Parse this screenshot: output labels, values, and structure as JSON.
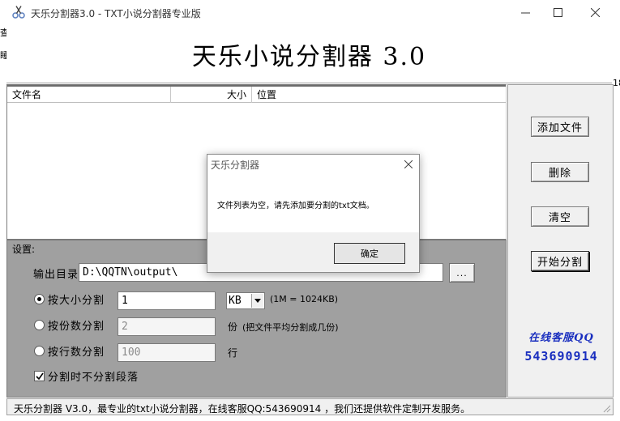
{
  "window": {
    "title": "天乐分割器3.0 - TXT小说分割器专业版",
    "icon": "scissors-icon",
    "controls": [
      "minimize",
      "maximize",
      "close"
    ]
  },
  "edge_fragments": [
    "查",
    "睡",
    "18"
  ],
  "banner": {
    "title": "天乐小说分割器 3.0"
  },
  "file_list": {
    "columns": [
      {
        "label": "文件名"
      },
      {
        "label": "大小"
      },
      {
        "label": "位置"
      }
    ],
    "rows": []
  },
  "right_panel": {
    "buttons": {
      "add_file": "添加文件",
      "delete": "删除",
      "clear": "清空",
      "start_split": "开始分割"
    },
    "service_label": "在线客服QQ",
    "service_number": "543690914"
  },
  "settings": {
    "title": "设置:",
    "output_dir_label": "输出目录",
    "output_dir_value": "D:\\QQTN\\output\\",
    "browse_label": "...",
    "split_by_size": {
      "label": "按大小分割",
      "checked": true,
      "value": "1",
      "unit": "KB",
      "note": "(1M = 1024KB)"
    },
    "split_by_parts": {
      "label": "按份数分割",
      "checked": false,
      "value": "2",
      "unit": "份",
      "note": "(把文件平均分割成几份)"
    },
    "split_by_lines": {
      "label": "按行数分割",
      "checked": false,
      "value": "100",
      "unit": "行"
    },
    "no_split_paragraph": {
      "label": "分割时不分割段落",
      "checked": true
    }
  },
  "status_bar": {
    "text": "天乐分割器 V3.0，最专业的txt小说分割器，在线客服QQ:543690914 ，我们还提供软件定制开发服务。"
  },
  "dialog": {
    "title": "天乐分割器",
    "message": "文件列表为空，请先添加要分割的txt文档。",
    "ok_label": "确定"
  },
  "colors": {
    "settings_bg": "#a0a0a0",
    "service_text": "#1a2fbf",
    "panel_bg": "#f0f0f0"
  }
}
